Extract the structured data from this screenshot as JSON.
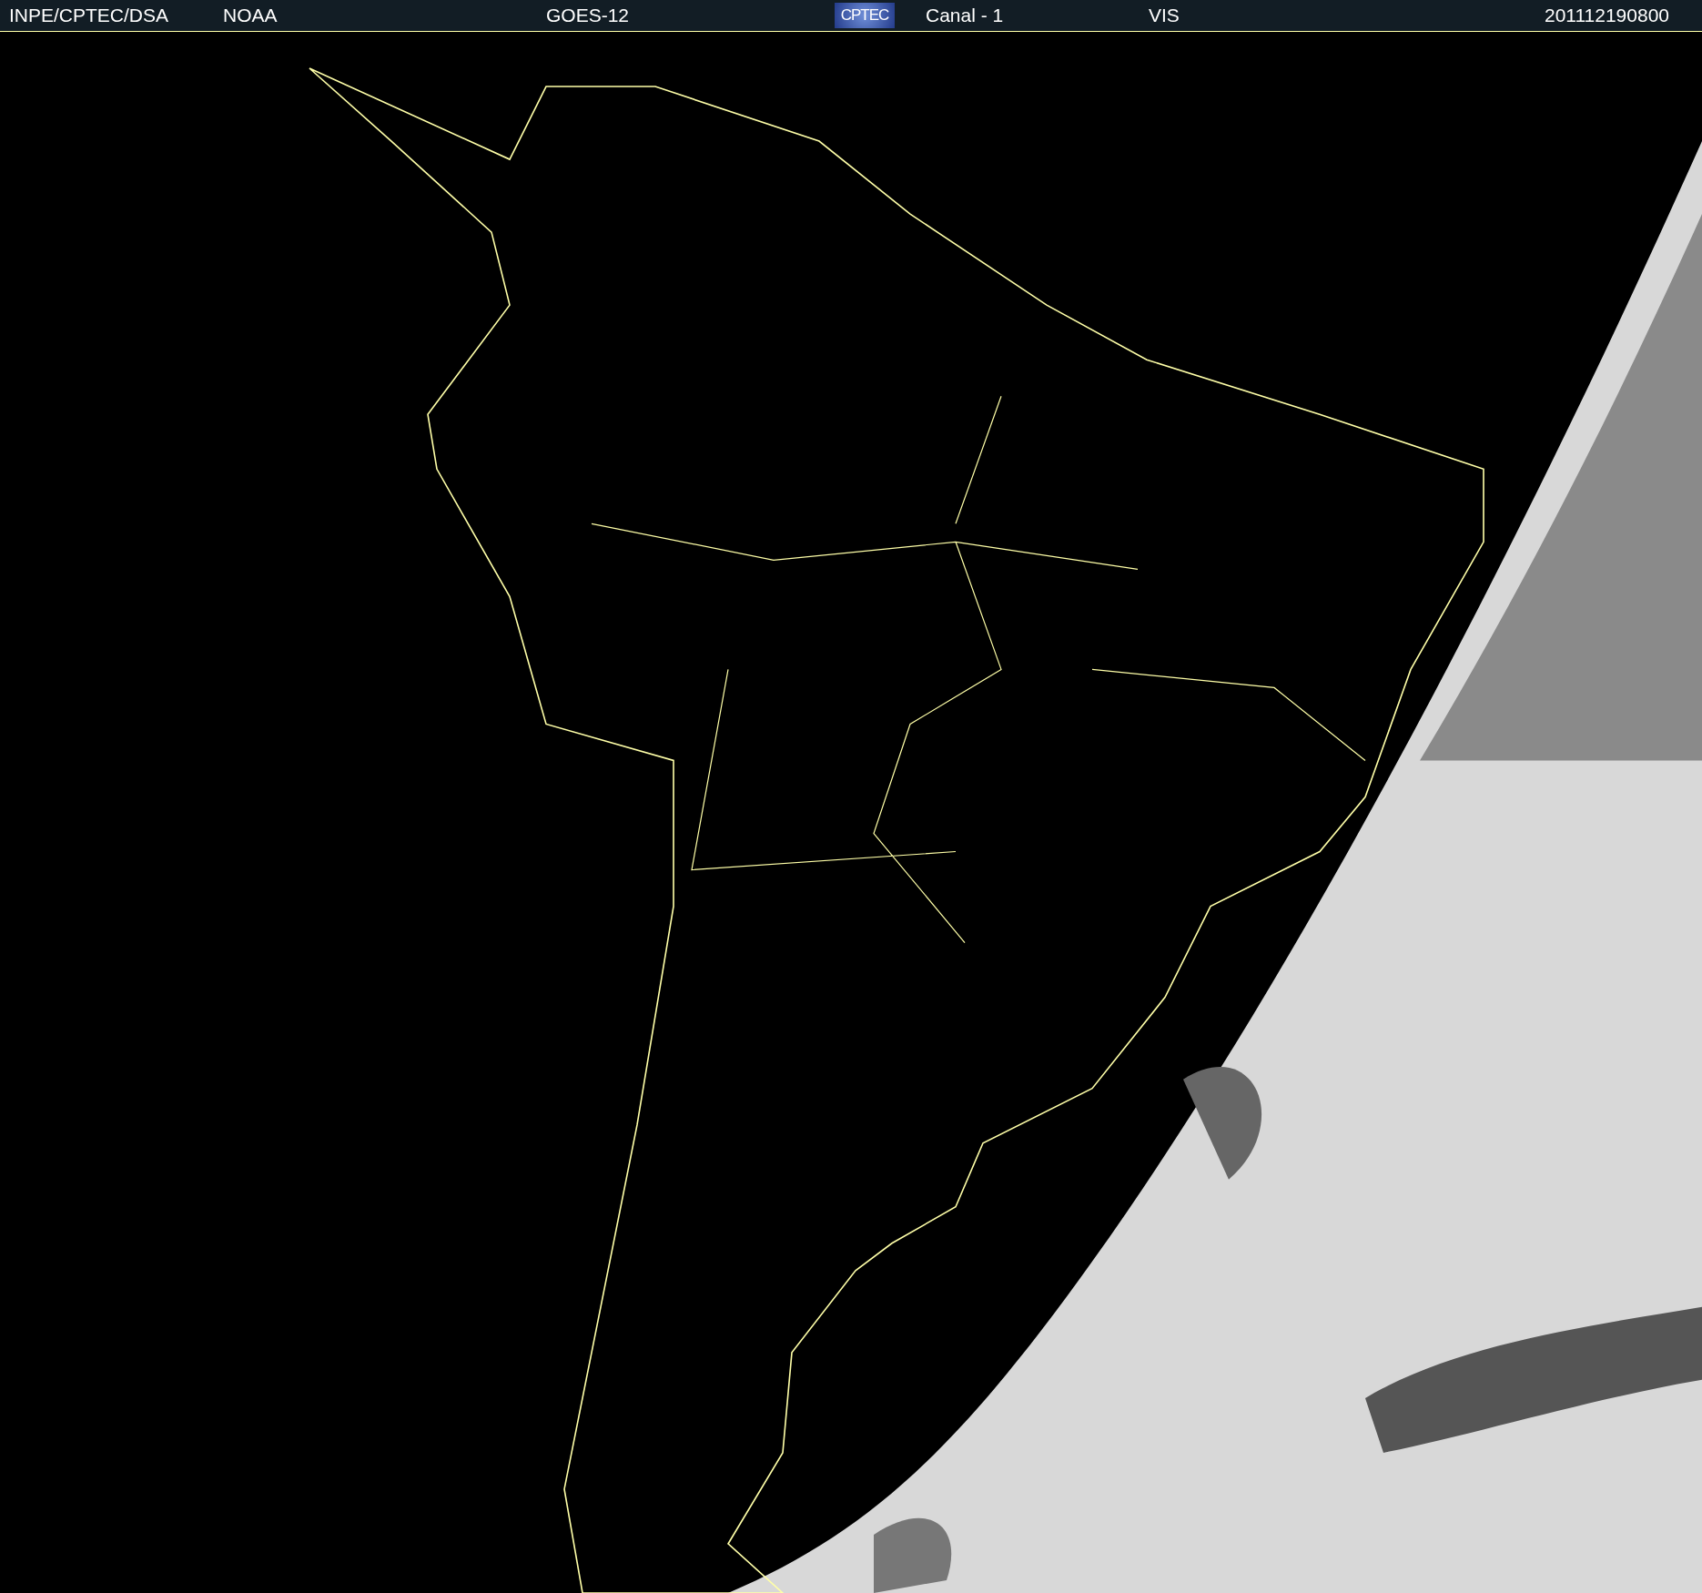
{
  "header": {
    "items": [
      {
        "kind": "text",
        "text": "INPE/CPTEC/DSA"
      },
      {
        "kind": "text",
        "text": "NOAA"
      },
      {
        "kind": "text",
        "text": "GOES-12"
      },
      {
        "kind": "logo",
        "text": "CPTEC"
      },
      {
        "kind": "text",
        "text": "Canal - 1"
      },
      {
        "kind": "text",
        "text": "VIS"
      },
      {
        "kind": "text",
        "text": "201112190800"
      }
    ]
  }
}
